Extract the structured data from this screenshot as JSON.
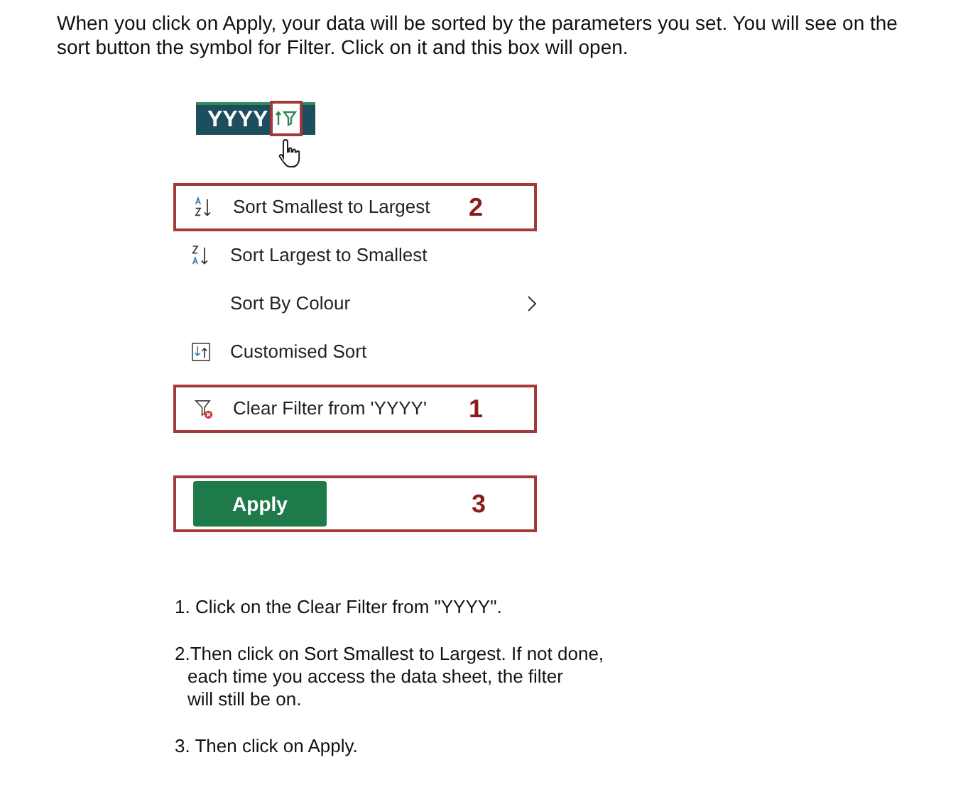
{
  "intro": "When you click on Apply, your data will be sorted by the parameters you set. You will see on the sort button the symbol for Filter. Click on it and this box will open.",
  "column_header": {
    "label": "YYYY",
    "filter_active": true
  },
  "menu": [
    {
      "kind": "sort-asc",
      "label": "Sort Smallest to Largest",
      "callout": "2"
    },
    {
      "kind": "sort-desc",
      "label": "Sort Largest to Smallest"
    },
    {
      "kind": "submenu",
      "label": "Sort By Colour"
    },
    {
      "kind": "custom-sort",
      "label": "Customised Sort"
    },
    {
      "kind": "clear-filter",
      "label": "Clear Filter from 'YYYY'",
      "callout": "1"
    }
  ],
  "apply_button": {
    "label": "Apply",
    "callout": "3"
  },
  "steps": [
    "1. Click on the Clear Filter from \"YYYY\".",
    "2.Then click on Sort Smallest to Largest. If not done,\neach time you access the data sheet, the filter\nwill still be on.",
    "3. Then click on Apply."
  ]
}
